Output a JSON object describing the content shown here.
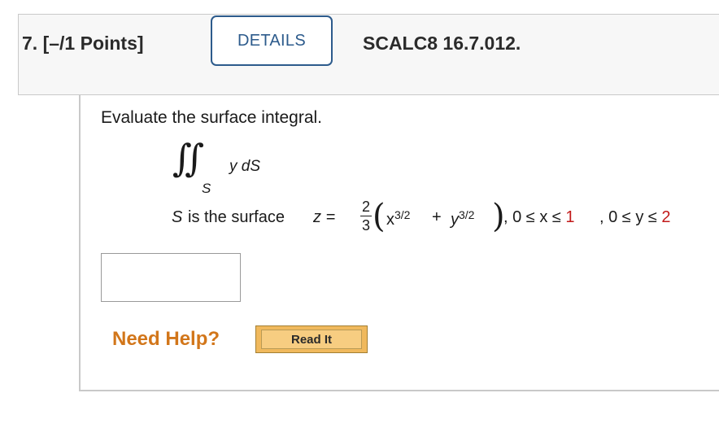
{
  "question": {
    "number": "7.",
    "points": "[–/1 Points]",
    "details_label": "DETAILS",
    "code": "SCALC8 16.7.012."
  },
  "problem": {
    "prompt": "Evaluate the surface integral.",
    "integral_symbol": "∬",
    "integral_subscript": "S",
    "integrand": "y dS",
    "surface_S": "S",
    "surface_is_text": "is the surface",
    "z_eq": "z =",
    "frac_num": "2",
    "frac_den": "3",
    "paren_open": "(",
    "paren_close": ")",
    "x_term": "x",
    "exp1": "3/2",
    "plus": "+",
    "y_term": "y",
    "exp2": "3/2",
    "range_x_prefix": ", 0 ≤ x ≤",
    "x_upper": "1",
    "range_y_prefix": ", 0 ≤ y ≤",
    "y_upper": "2",
    "bound_color": "#c21a1a"
  },
  "answer": {
    "value": ""
  },
  "help": {
    "label": "Need Help?",
    "read_it_label": "Read It"
  },
  "colors": {
    "details_border": "#2d5b8c",
    "need_help": "#d2761a",
    "read_it_bg": "#f0b95d"
  }
}
